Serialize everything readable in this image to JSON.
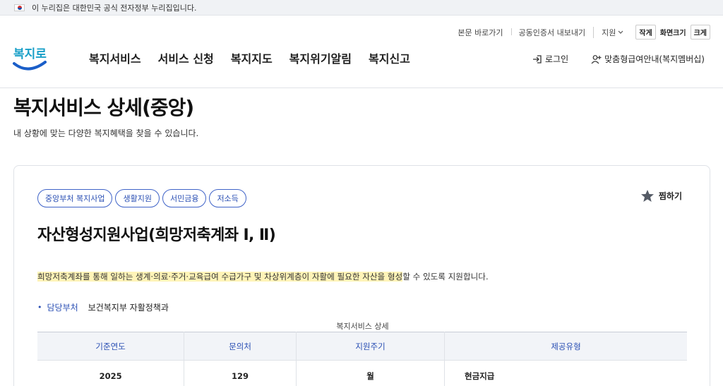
{
  "gov_banner": {
    "text": "이 누리집은 대한민국 공식 전자정부 누리집입니다."
  },
  "util_nav": {
    "skip": "본문 바로가기",
    "cert": "공동인증서 내보내기",
    "lang": "지원",
    "font_small": "작게",
    "font_size": "화면크기",
    "font_large": "크게"
  },
  "logo": {
    "text": "복지로"
  },
  "gnb": [
    "복지서비스",
    "서비스 신청",
    "복지지도",
    "복지위기알림",
    "복지신고"
  ],
  "header_right": {
    "login": "로그인",
    "custom": "맞춤형급여안내(복지멤버십)"
  },
  "page": {
    "title": "복지서비스 상세(중앙)",
    "subtitle": "내 상황에 맞는 다양한 복지혜택을 찾을 수 있습니다."
  },
  "service": {
    "tags": [
      "중앙부처 복지사업",
      "생활지원",
      "서민금융",
      "저소득"
    ],
    "bookmark": "찜하기",
    "title": "자산형성지원사업(희망저축계좌 Ⅰ, Ⅱ)",
    "desc_highlight": "희망저축계좌를 통해 일하는 생계·의료·주거·교육급여 수급가구 및 차상위계층이 자활에 필요한 자산을 형성",
    "desc_rest": "할 수 있도록 지원합니다.",
    "dept_label": "담당부처",
    "dept_value": "보건복지부 자활정책과"
  },
  "detail_table": {
    "caption": "복지서비스 상세",
    "headers": [
      "기준연도",
      "문의처",
      "지원주기",
      "제공유형"
    ],
    "row": [
      "2025",
      "129",
      "월",
      "현금지급"
    ]
  },
  "colors": {
    "accent": "#2a4fb4",
    "highlight": "#fff4b8",
    "banner_bg": "#f0f2f5"
  }
}
